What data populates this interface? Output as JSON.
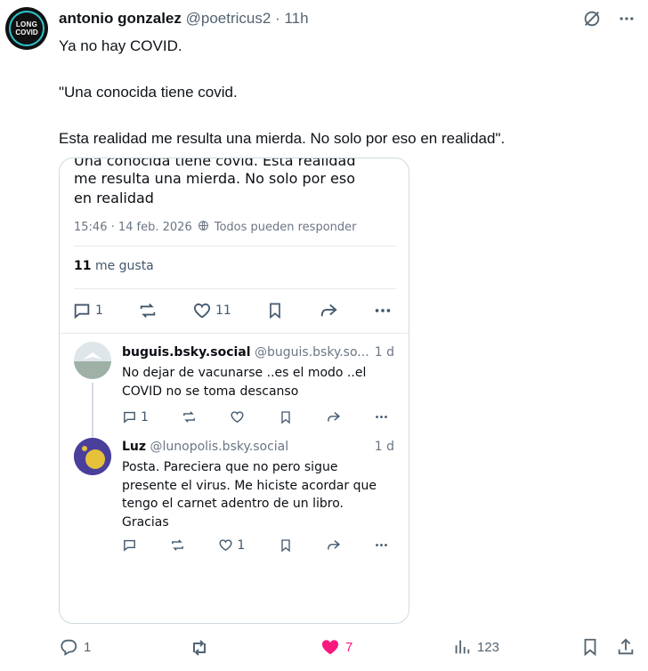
{
  "author": {
    "name": "antonio gonzalez",
    "handle": "@poetricus2",
    "time": "· 11h",
    "avatar_text_1": "LONG",
    "avatar_text_2": "COVID"
  },
  "tweet": {
    "line1": "Ya no hay COVID.",
    "line2": "\"Una conocida tiene covid.",
    "line3": "Esta realidad me resulta una mierda. No solo por eso en realidad\"."
  },
  "embed": {
    "cut_text": "Una conocida tiene covid. Esta realidad",
    "body_text": "me resulta una mierda. No solo por eso en realidad",
    "timestamp": "15:46 · 14 feb. 2026",
    "reply_setting": "Todos pueden responder",
    "likes_count": "11",
    "likes_label": "me gusta",
    "actions": {
      "replies": "1",
      "likes": "11"
    },
    "replies": [
      {
        "name": "buguis.bsky.social",
        "handle": "@buguis.bsky.so...",
        "time": "1 d",
        "text": "No dejar de vacunarse ..es el modo ..el COVID no se toma descanso",
        "reply_count": "1",
        "like_count": ""
      },
      {
        "name": "Luz",
        "handle": "@lunopolis.bsky.social",
        "time": "1 d",
        "text": "Posta. Pareciera que no pero sigue presente el virus. Me hiciste acordar que tengo el carnet adentro de un libro. Gracias",
        "reply_count": "",
        "like_count": "1"
      }
    ]
  },
  "bottom": {
    "replies": "1",
    "likes": "7",
    "views": "123"
  },
  "colors": {
    "like": "#f91880",
    "muted": "#536471",
    "border": "#cfd9de"
  }
}
